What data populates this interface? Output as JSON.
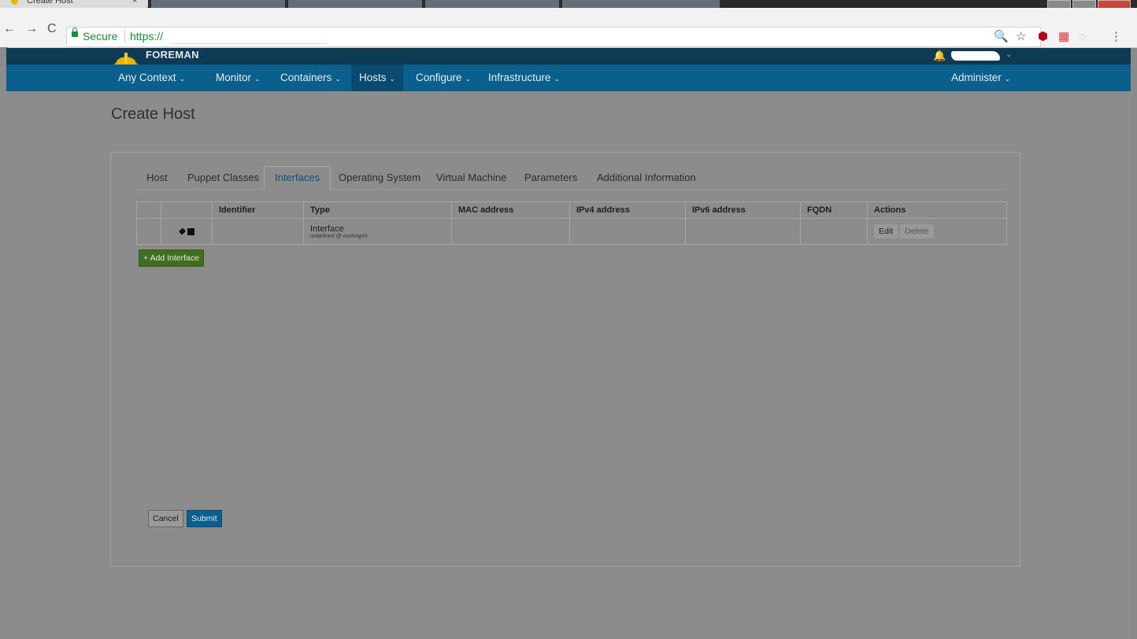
{
  "browser": {
    "tab_title": "Create Host",
    "tab_close": "×",
    "secure_label": "Secure",
    "url": "https://",
    "nav_back": "←",
    "nav_forward": "→",
    "nav_reload": "C"
  },
  "header": {
    "brand": "FOREMAN",
    "menu": [
      {
        "label": "Any Context"
      },
      {
        "label": "Monitor"
      },
      {
        "label": "Containers"
      },
      {
        "label": "Hosts"
      },
      {
        "label": "Configure"
      },
      {
        "label": "Infrastructure"
      },
      {
        "label": "Administer"
      }
    ]
  },
  "page": {
    "title": "Create Host",
    "tabs": [
      "Host",
      "Puppet Classes",
      "Interfaces",
      "Operating System",
      "Virtual Machine",
      "Parameters",
      "Additional Information"
    ],
    "active_tab": "Interfaces"
  },
  "interfaces": {
    "columns": [
      "",
      "",
      "Identifier",
      "Type",
      "MAC address",
      "IPv4 address",
      "IPv6 address",
      "FQDN",
      "Actions"
    ],
    "rows": [
      {
        "identifier": "",
        "type": "Interface",
        "type_detail": "undefined @ ovirtmgmt",
        "mac": "",
        "ipv4": "",
        "ipv6": "",
        "fqdn": "",
        "edit_label": "Edit",
        "delete_label": "Delete"
      }
    ],
    "add_label": "+ Add Interface"
  },
  "form": {
    "cancel_label": "Cancel",
    "submit_label": "Submit"
  },
  "colors": {
    "brand_bar": "#0d3a55",
    "menu_bar": "#0a5f8c",
    "add_button": "#3f6e22",
    "submit_button": "#0a5f8c"
  }
}
